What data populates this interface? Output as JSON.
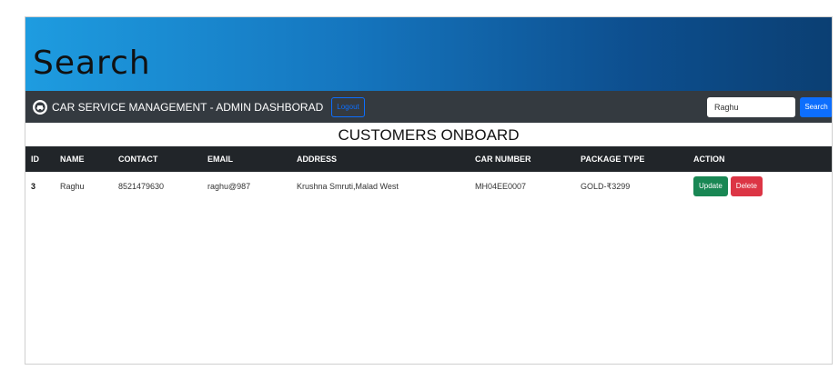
{
  "banner": {
    "title": "Search"
  },
  "navbar": {
    "brand": "CAR SERVICE MANAGEMENT - ADMIN DASHBORAD",
    "logout_label": "Logout",
    "search_value": "Raghu",
    "search_button": "Search"
  },
  "page": {
    "heading": "CUSTOMERS ONBOARD"
  },
  "table": {
    "headers": [
      "ID",
      "NAME",
      "CONTACT",
      "EMAIL",
      "ADDRESS",
      "CAR NUMBER",
      "PACKAGE TYPE",
      "ACTION"
    ],
    "rows": [
      {
        "id": "3",
        "name": "Raghu",
        "contact": "8521479630",
        "email": "raghu@987",
        "address": "Krushna Smruti,Malad West",
        "car_number": "MH04EE0007",
        "package_type": "GOLD-₹3299",
        "update_label": "Update",
        "delete_label": "Delete"
      }
    ]
  },
  "colors": {
    "navbar": "#343a40",
    "table_header": "#212529",
    "primary": "#0d6efd",
    "success": "#198754",
    "danger": "#dc3545"
  },
  "icons": {
    "brand": "car-icon"
  }
}
